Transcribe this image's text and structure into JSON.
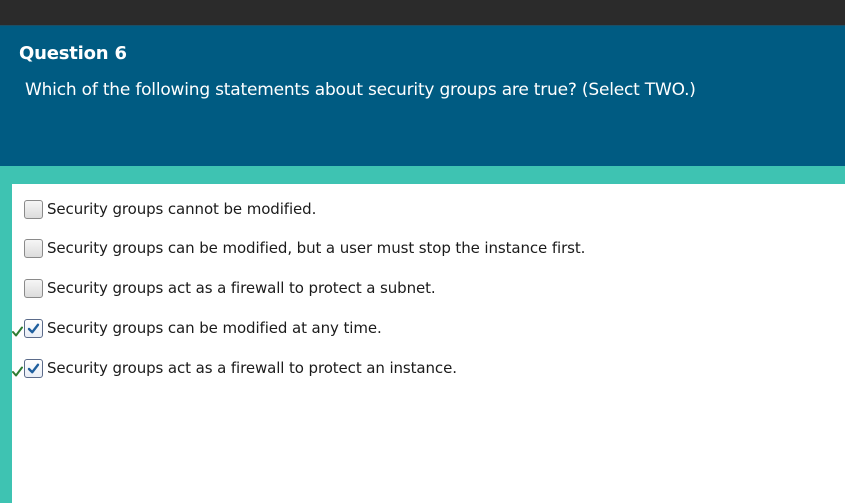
{
  "question": {
    "number_label": "Question 6",
    "text": "Which of the following statements about security groups are true? (Select TWO.)"
  },
  "options": [
    {
      "label": "Security groups cannot be modified.",
      "checked": false,
      "correct": false
    },
    {
      "label": "Security groups can be modified, but a user must stop the instance first.",
      "checked": false,
      "correct": false
    },
    {
      "label": "Security groups act as a firewall to protect a subnet.",
      "checked": false,
      "correct": false
    },
    {
      "label": "Security groups can be modified at any time.",
      "checked": true,
      "correct": true
    },
    {
      "label": "Security groups act as a firewall to protect an instance.",
      "checked": true,
      "correct": true
    }
  ],
  "colors": {
    "header_bg": "#005b82",
    "accent_teal": "#3ec3b2",
    "check_blue": "#1f5f9e",
    "correct_green": "#2e7d32"
  }
}
